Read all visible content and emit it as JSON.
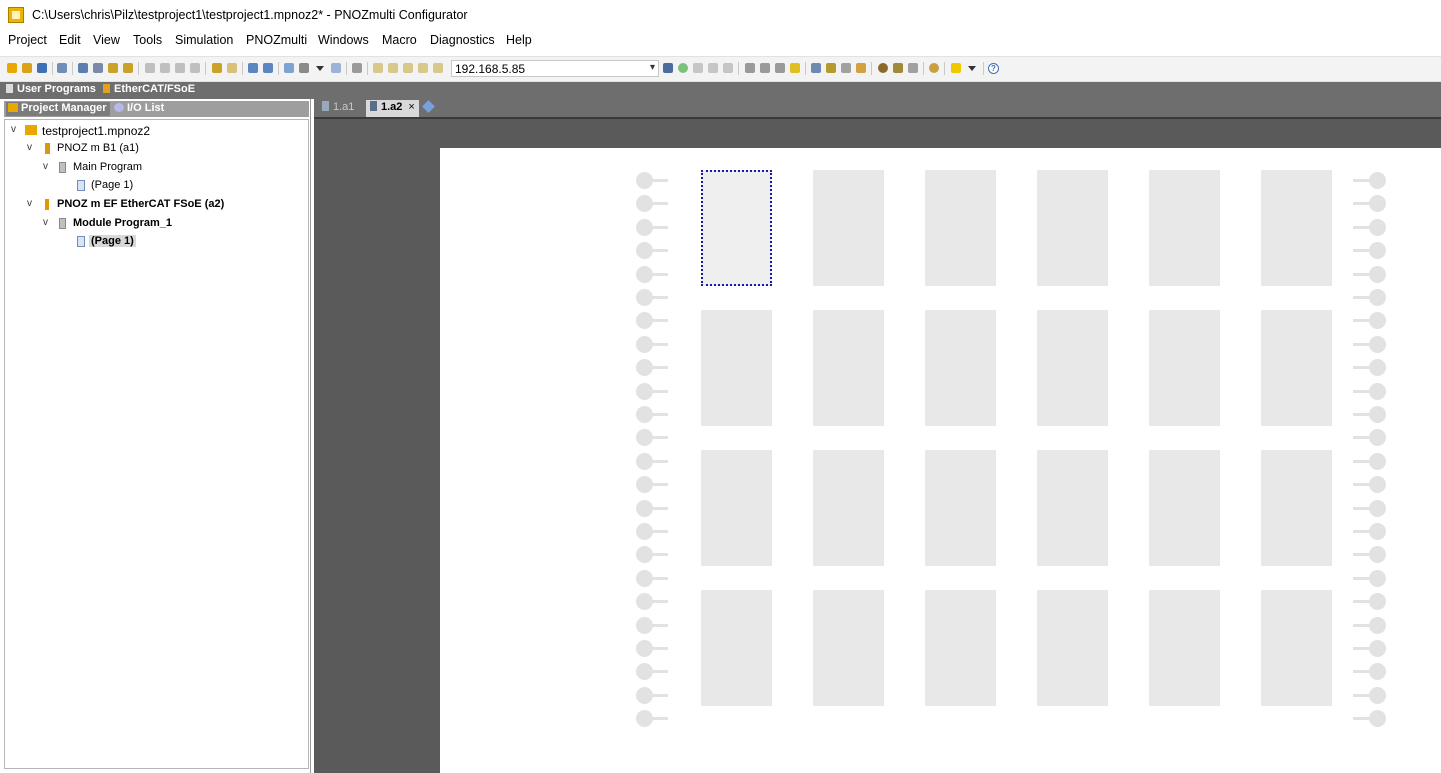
{
  "window": {
    "title": "C:\\Users\\chris\\Pilz\\testproject1\\testproject1.mpnoz2* - PNOZmulti Configurator",
    "app_icon": "pnozmulti-app-icon"
  },
  "menu": {
    "items": [
      "Project",
      "Edit",
      "View",
      "Tools",
      "Simulation",
      "PNOZmulti",
      "Windows",
      "Macro",
      "Diagnostics",
      "Help"
    ]
  },
  "toolbar": {
    "ip_address": "192.168.5.85",
    "dropdown_arrow": "▾",
    "help_icon": "help-icon"
  },
  "panel_tabs": {
    "user_programs": "User Programs",
    "ethercat": "EtherCAT/FSoE"
  },
  "left_panel": {
    "tabs": {
      "project_manager": "Project Manager",
      "io_list": "I/O List"
    },
    "tree": {
      "project": "testproject1.mpnoz2",
      "device1": "PNOZ m B1 (a1)",
      "main_program": "Main Program",
      "page1_a": "(Page 1)",
      "device2": "PNOZ m EF EtherCAT FSoE (a2)",
      "module_program": "Module Program_1",
      "page1_b": "(Page 1)"
    },
    "expander": "v"
  },
  "editor": {
    "tabs": {
      "a1": "1.a1",
      "a2": "1.a2",
      "close": "×"
    },
    "grid": {
      "rows": 4,
      "columns": 6,
      "selected_slot": "row 1, column 1"
    }
  },
  "colors": {
    "accent_selection": "#1a1aa8",
    "slot_fill": "#e8e8e8",
    "canvas_background": "#5a5a5a"
  }
}
